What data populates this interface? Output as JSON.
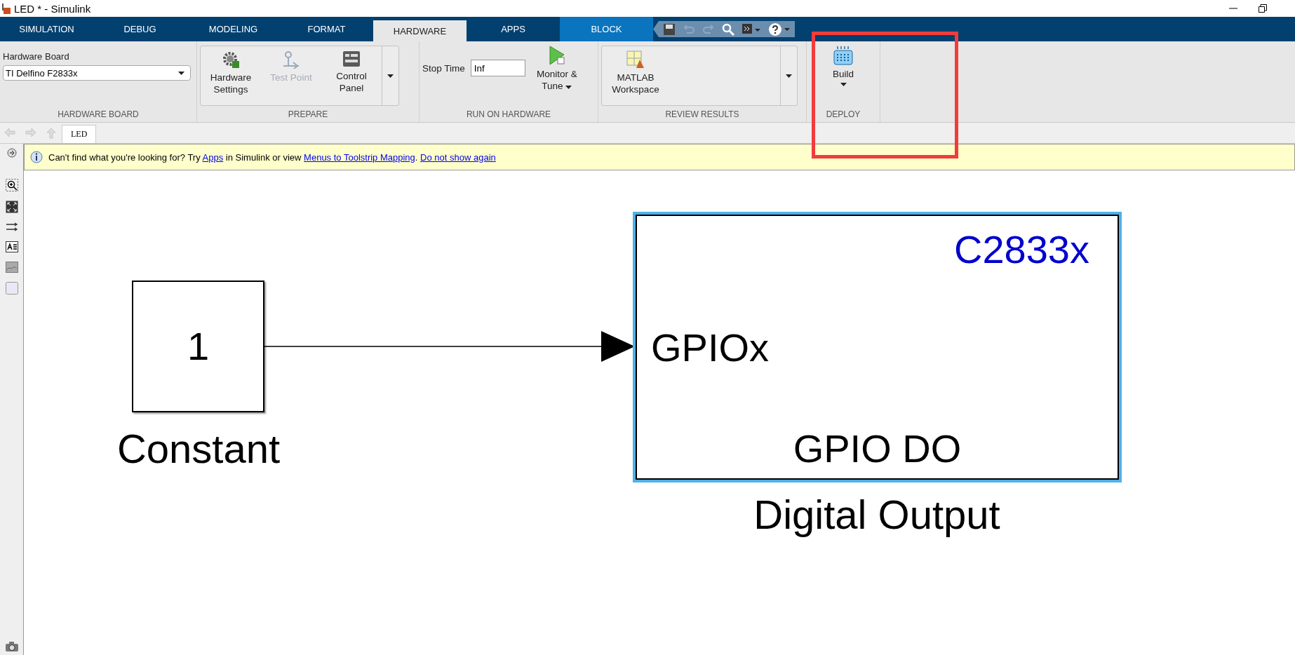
{
  "window": {
    "title": "LED * - Simulink"
  },
  "tabs": [
    {
      "label": "SIMULATION",
      "selected": false,
      "kind": "normal"
    },
    {
      "label": "DEBUG",
      "selected": false,
      "kind": "normal"
    },
    {
      "label": "MODELING",
      "selected": false,
      "kind": "normal"
    },
    {
      "label": "FORMAT",
      "selected": false,
      "kind": "normal"
    },
    {
      "label": "HARDWARE",
      "selected": true,
      "kind": "normal"
    },
    {
      "label": "APPS",
      "selected": false,
      "kind": "normal"
    },
    {
      "label": "BLOCK",
      "selected": false,
      "kind": "contextual"
    }
  ],
  "ribbon": {
    "hardware_board": {
      "label": "Hardware Board",
      "value": "TI Delfino F2833x",
      "footer": "HARDWARE BOARD"
    },
    "prepare": {
      "buttons": [
        {
          "label": "Hardware Settings",
          "disabled": false,
          "kind": "gear"
        },
        {
          "label": "Test Point",
          "disabled": true,
          "kind": "probe"
        },
        {
          "label": "Control Panel",
          "disabled": false,
          "kind": "panel"
        }
      ],
      "footer": "PREPARE"
    },
    "run_on_hardware": {
      "stop_time_label": "Stop Time",
      "stop_time": "Inf",
      "monitor_button": "Monitor & Tune",
      "footer": "RUN ON HARDWARE"
    },
    "review_results": {
      "button": "MATLAB Workspace",
      "footer": "REVIEW RESULTS"
    },
    "deploy": {
      "button": "Build",
      "footer": "DEPLOY"
    }
  },
  "breadcrumb": {
    "tab": "LED"
  },
  "info_bar": {
    "parts": [
      {
        "kind": "text",
        "text": "Can't find what you're looking for? Try "
      },
      {
        "kind": "link",
        "text": "Apps"
      },
      {
        "kind": "text",
        "text": " in Simulink or view "
      },
      {
        "kind": "link",
        "text": "Menus to Toolstrip Mapping"
      },
      {
        "kind": "text",
        "text": ". "
      },
      {
        "kind": "link",
        "text": "Do not show again"
      }
    ]
  },
  "canvas": {
    "constant_block": {
      "value": "1",
      "name": "Constant",
      "selected": false
    },
    "digital_output_block": {
      "target": "C2833x",
      "port": "GPIOx",
      "function": "GPIO DO",
      "name": "Digital Output",
      "selected": true
    }
  }
}
